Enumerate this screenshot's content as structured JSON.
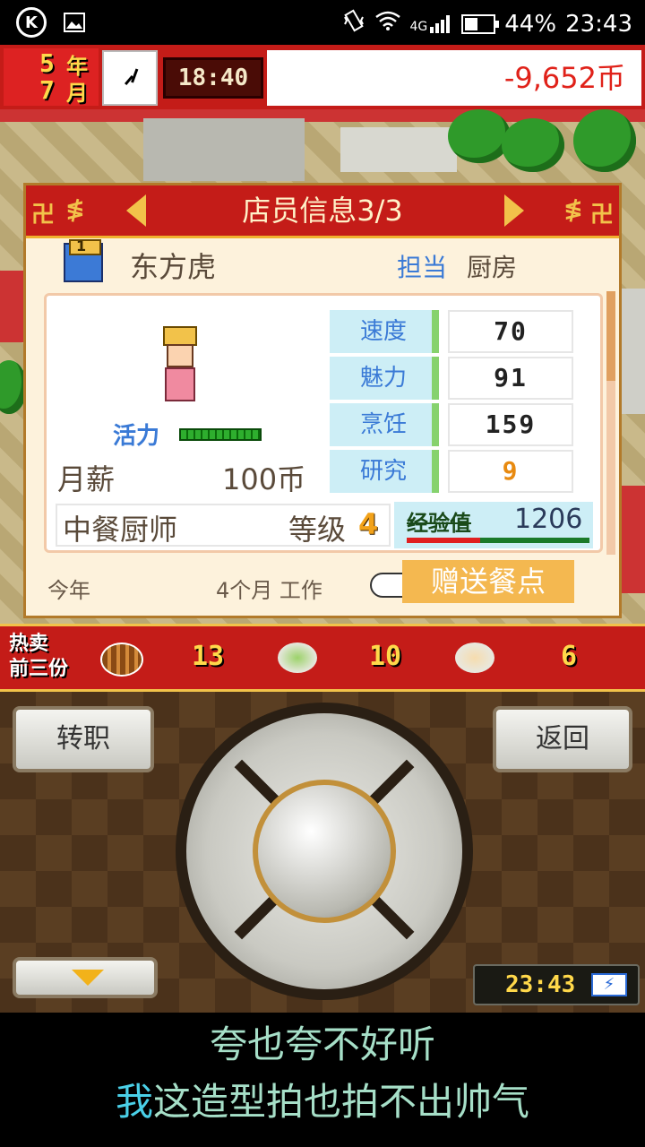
{
  "status_bar": {
    "battery_percent": "44%",
    "time": "23:43",
    "network": "4G",
    "icons": [
      "k-icon",
      "image-icon",
      "vibrate-icon",
      "wifi-icon",
      "signal-icon",
      "battery-icon"
    ]
  },
  "top_bar": {
    "year": "5",
    "year_unit": "年",
    "month": "7",
    "month_unit": "月",
    "game_time": "18:40",
    "money": "-9,652币"
  },
  "panel": {
    "title": "店员信息3/3",
    "staff_rank": "1",
    "staff_name": "东方虎",
    "duty_label": "担当",
    "duty_value": "厨房",
    "vitality_label": "活力",
    "salary_label": "月薪",
    "salary_value": "100币",
    "stats": [
      {
        "name": "速度",
        "value": "70"
      },
      {
        "name": "魅力",
        "value": "91"
      },
      {
        "name": "烹饪",
        "value": "159"
      },
      {
        "name": "研究",
        "value": "9"
      }
    ],
    "job_name": "中餐厨师",
    "level_label": "等级",
    "level_value": "4",
    "exp_label": "经验值",
    "exp_value": "1206",
    "exp_fraction": 0.4,
    "year_label": "今年",
    "months_worked": "4个月 工作",
    "gift_button": "赠送餐点"
  },
  "hot_sales": {
    "label_line1": "热卖",
    "label_line2": "前三份",
    "items": [
      {
        "icon": "skewer-icon",
        "count": "13"
      },
      {
        "icon": "salad-icon",
        "count": "10"
      },
      {
        "icon": "tofu-icon",
        "count": "6"
      }
    ]
  },
  "controls": {
    "transfer_button": "转职",
    "back_button": "返回",
    "clock_time": "23:43"
  },
  "subtitles": {
    "line1": "夸也夸不好听",
    "line2_first": "我",
    "line2_rest": "这造型拍也拍不出帅气"
  },
  "colors": {
    "primary_red": "#c41c18",
    "gold": "#f2c24a",
    "panel_bg": "#fdf2dc",
    "stat_blue": "#3a7ad6",
    "money_red": "#e0221a",
    "subtitle_green": "#a6dfc8"
  }
}
